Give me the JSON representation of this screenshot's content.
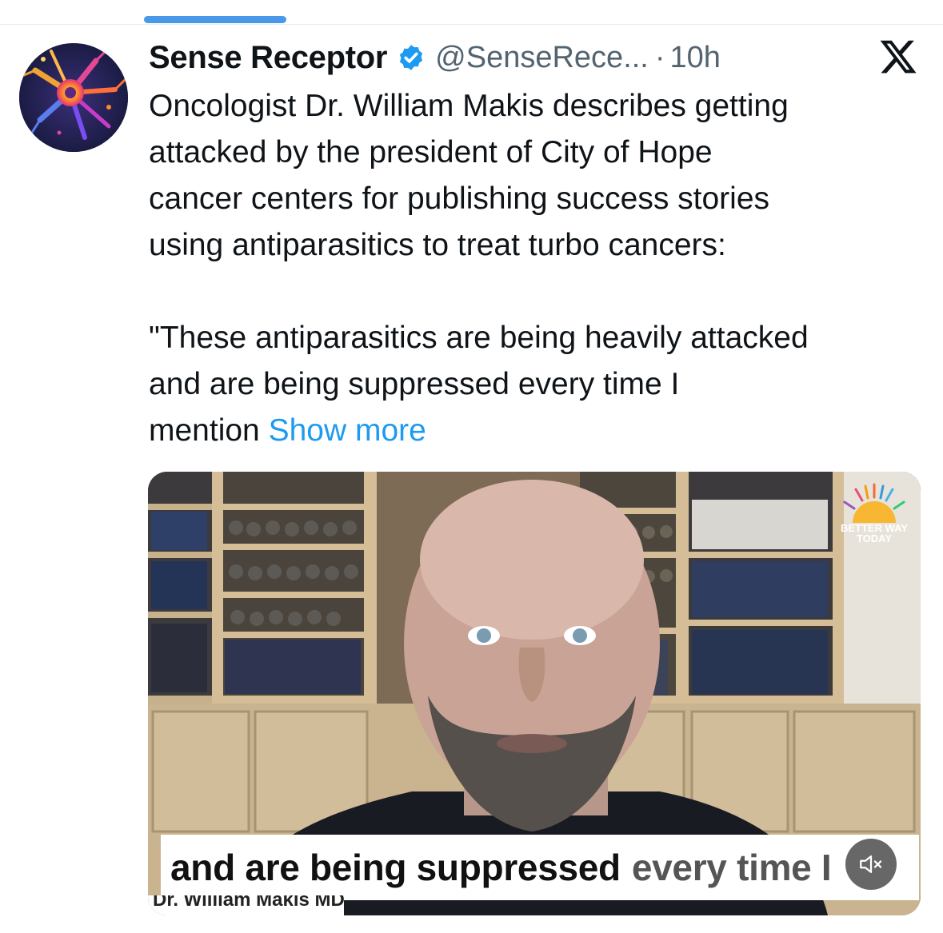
{
  "tweet": {
    "display_name": "Sense Receptor",
    "handle": "@SenseRece...",
    "separator": "·",
    "timestamp": "10h",
    "lines": [
      "Oncologist Dr. William Makis describes getting",
      "attacked by the president of City of Hope",
      "cancer centers for publishing success stories",
      "using antiparasitics to treat turbo cancers:"
    ],
    "quote_lines": [
      "\"These antiparasitics are being heavily attacked",
      "and are being suppressed every time I"
    ],
    "last_line_prefix": "mention ",
    "show_more_label": "Show more"
  },
  "video": {
    "caption_strong": "and are being suppressed",
    "caption_light": "every time I",
    "nameplate": "Dr. William Makis MD",
    "brand_line1": "BETTER WAY",
    "brand_line2": "TODAY"
  },
  "icons": {
    "avatar": "neuron-avatar",
    "verified": "verified-badge-icon",
    "platform": "x-logo-icon",
    "mute": "muted-speaker-icon"
  },
  "colors": {
    "accent": "#1d9bf0",
    "text": "#0f1419",
    "secondary_text": "#536471",
    "top_indicator": "#4a99e9"
  }
}
